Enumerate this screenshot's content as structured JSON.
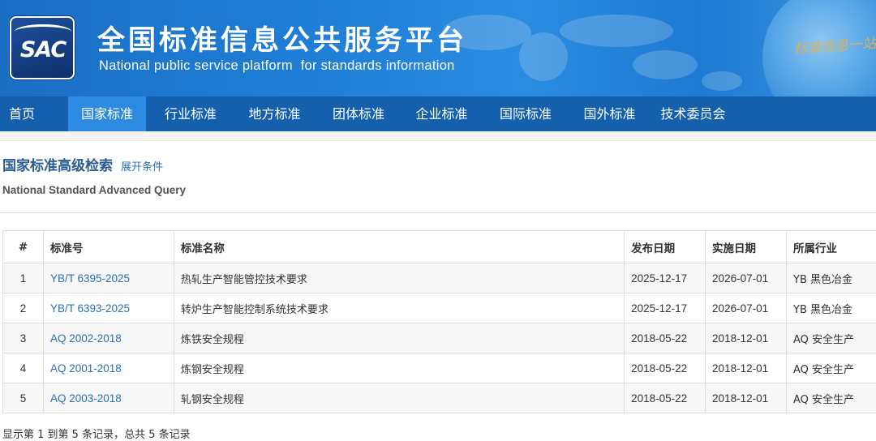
{
  "header": {
    "logo_text": "SAC",
    "title_cn": "全国标准信息公共服务平台",
    "title_en": "National public service platform  for standards information",
    "slogan": "标准信息一站式"
  },
  "nav": {
    "items": [
      {
        "label": "首页",
        "active": false
      },
      {
        "label": "国家标准",
        "active": true
      },
      {
        "label": "行业标准",
        "active": false
      },
      {
        "label": "地方标准",
        "active": false
      },
      {
        "label": "团体标准",
        "active": false
      },
      {
        "label": "企业标准",
        "active": false
      },
      {
        "label": "国际标准",
        "active": false
      },
      {
        "label": "国外标准",
        "active": false
      },
      {
        "label": "技术委员会",
        "active": false
      }
    ]
  },
  "search": {
    "title": "国家标准高级检索",
    "toggle_label": "展开条件",
    "subtitle": "National Standard Advanced Query"
  },
  "table": {
    "headers": [
      "#",
      "标准号",
      "标准名称",
      "发布日期",
      "实施日期",
      "所属行业"
    ],
    "rows": [
      {
        "num": "1",
        "code": "YB/T 6395-2025",
        "name": "热轧生产智能管控技术要求",
        "publish": "2025-12-17",
        "implement": "2026-07-01",
        "industry": "YB 黑色冶金"
      },
      {
        "num": "2",
        "code": "YB/T 6393-2025",
        "name": "转炉生产智能控制系统技术要求",
        "publish": "2025-12-17",
        "implement": "2026-07-01",
        "industry": "YB 黑色冶金"
      },
      {
        "num": "3",
        "code": "AQ 2002-2018",
        "name": "炼铁安全规程",
        "publish": "2018-05-22",
        "implement": "2018-12-01",
        "industry": "AQ 安全生产"
      },
      {
        "num": "4",
        "code": "AQ 2001-2018",
        "name": "炼钢安全规程",
        "publish": "2018-05-22",
        "implement": "2018-12-01",
        "industry": "AQ 安全生产"
      },
      {
        "num": "5",
        "code": "AQ 2003-2018",
        "name": "轧钢安全规程",
        "publish": "2018-05-22",
        "implement": "2018-12-01",
        "industry": "AQ 安全生产"
      }
    ]
  },
  "footer_note": "显示第 1 到第 5 条记录，总共 5 条记录",
  "colors": {
    "nav_bg": "#1560ad",
    "nav_active": "#2c8be0",
    "link": "#2a6fb5",
    "title": "#2a5d8f"
  }
}
